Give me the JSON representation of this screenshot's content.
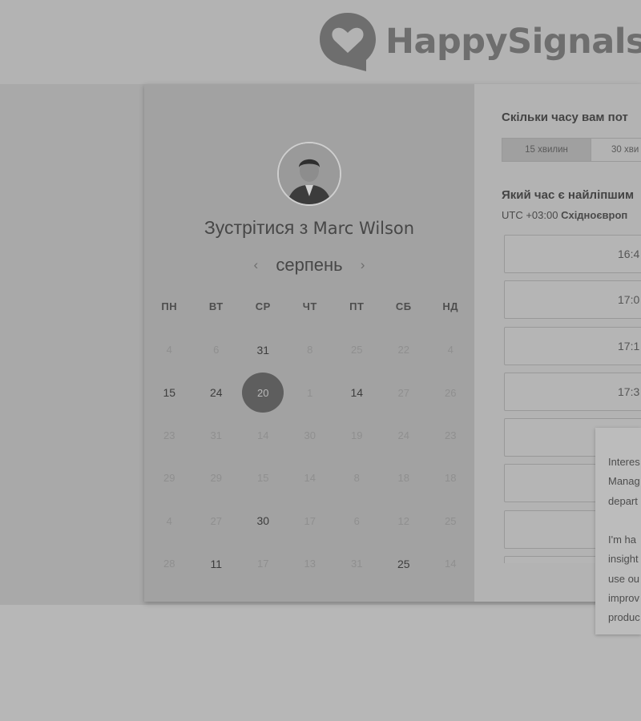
{
  "brand": {
    "name": "HappySignals"
  },
  "booking": {
    "title_prefix": "Зустрітися з",
    "host_name": "Marc Wilson",
    "month": "серпень",
    "prev_icon": "‹",
    "next_icon": "›",
    "weekdays": [
      "ПН",
      "ВТ",
      "СР",
      "ЧТ",
      "ПТ",
      "СБ",
      "НД"
    ],
    "weeks": [
      [
        {
          "d": "4",
          "a": false
        },
        {
          "d": "6",
          "a": false
        },
        {
          "d": "31",
          "a": true
        },
        {
          "d": "8",
          "a": false
        },
        {
          "d": "25",
          "a": false
        },
        {
          "d": "22",
          "a": false
        },
        {
          "d": "4",
          "a": false
        }
      ],
      [
        {
          "d": "15",
          "a": true
        },
        {
          "d": "24",
          "a": true
        },
        {
          "d": "20",
          "a": true,
          "sel": true
        },
        {
          "d": "1",
          "a": false
        },
        {
          "d": "14",
          "a": true
        },
        {
          "d": "27",
          "a": false
        },
        {
          "d": "26",
          "a": false
        }
      ],
      [
        {
          "d": "23",
          "a": false
        },
        {
          "d": "31",
          "a": false
        },
        {
          "d": "14",
          "a": false
        },
        {
          "d": "30",
          "a": false
        },
        {
          "d": "19",
          "a": false
        },
        {
          "d": "24",
          "a": false
        },
        {
          "d": "23",
          "a": false
        }
      ],
      [
        {
          "d": "29",
          "a": false
        },
        {
          "d": "29",
          "a": false
        },
        {
          "d": "15",
          "a": false
        },
        {
          "d": "14",
          "a": false
        },
        {
          "d": "8",
          "a": false
        },
        {
          "d": "18",
          "a": false
        },
        {
          "d": "18",
          "a": false
        }
      ],
      [
        {
          "d": "4",
          "a": false
        },
        {
          "d": "27",
          "a": false
        },
        {
          "d": "30",
          "a": true
        },
        {
          "d": "17",
          "a": false
        },
        {
          "d": "6",
          "a": false
        },
        {
          "d": "12",
          "a": false
        },
        {
          "d": "25",
          "a": false
        }
      ],
      [
        {
          "d": "28",
          "a": false
        },
        {
          "d": "11",
          "a": true
        },
        {
          "d": "17",
          "a": false
        },
        {
          "d": "13",
          "a": false
        },
        {
          "d": "31",
          "a": false
        },
        {
          "d": "25",
          "a": true
        },
        {
          "d": "14",
          "a": false
        }
      ]
    ]
  },
  "schedule": {
    "duration_question": "Скільки часу вам пот",
    "durations": [
      "15 хвилин",
      "30 хви"
    ],
    "time_question": "Який час є найліпшим",
    "timezone_prefix": "UTC +03:00",
    "timezone_name": "Східноєвроп",
    "slots": [
      "16:4",
      "17:0",
      "17:1",
      "17:3",
      "",
      "",
      "",
      ""
    ]
  },
  "popup": {
    "lines": [
      "Interes",
      "Manag",
      "depart",
      "",
      "I'm ha",
      "insight",
      "use ou",
      "improv",
      "produc"
    ]
  },
  "colors": {
    "selected_day": "#5e5e5e",
    "left_panel": "#a2a2a2",
    "right_panel": "#b3b3b3"
  }
}
